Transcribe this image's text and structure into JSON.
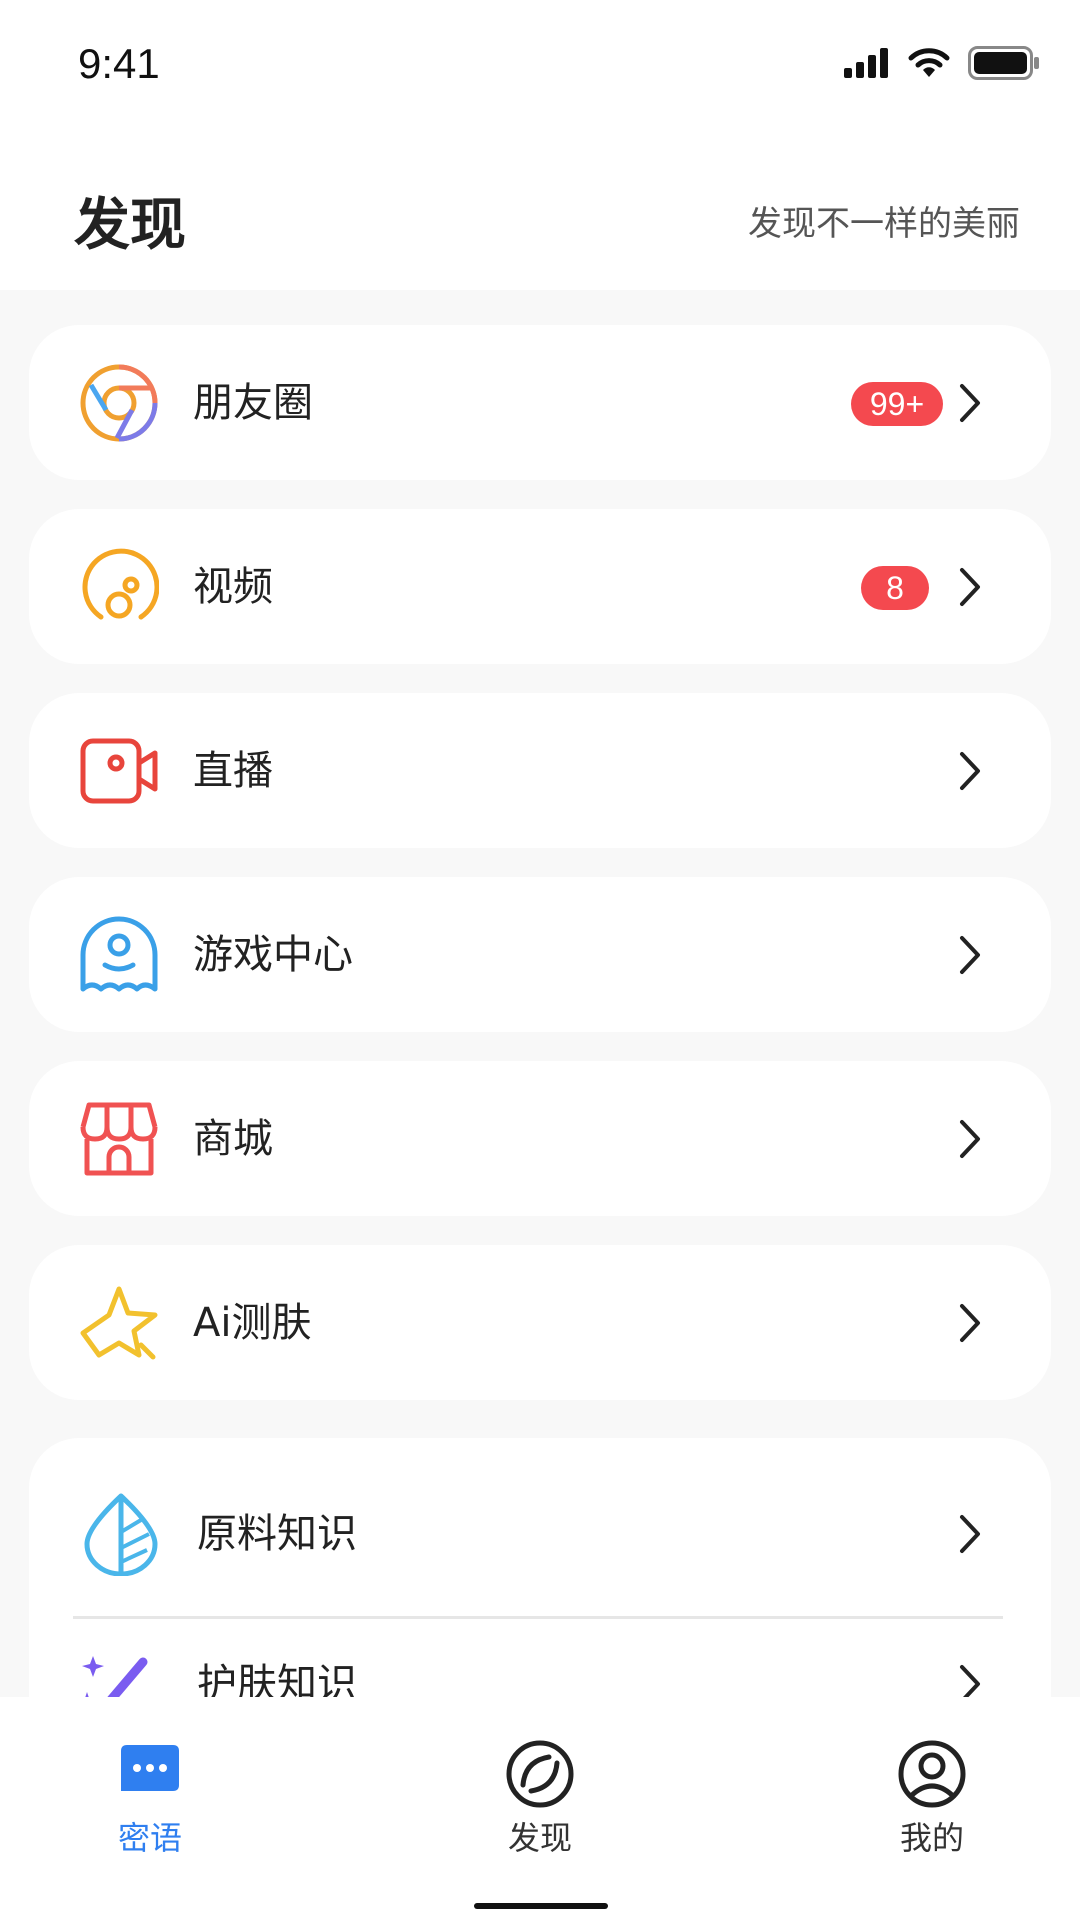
{
  "status": {
    "time": "9:41"
  },
  "header": {
    "title": "发现",
    "subtitle": "发现不一样的美丽"
  },
  "menu": [
    {
      "id": "moments",
      "label": "朋友圈",
      "badge": "99+"
    },
    {
      "id": "video",
      "label": "视频",
      "badge": "8"
    },
    {
      "id": "live",
      "label": "直播",
      "badge": ""
    },
    {
      "id": "games",
      "label": "游戏中心",
      "badge": ""
    },
    {
      "id": "mall",
      "label": "商城",
      "badge": ""
    },
    {
      "id": "ai-skin",
      "label": "Ai测肤",
      "badge": ""
    }
  ],
  "knowledge": [
    {
      "id": "ingredient",
      "label": "原料知识"
    },
    {
      "id": "skincare",
      "label": "护肤知识"
    }
  ],
  "tabs": [
    {
      "label": "密语",
      "active": true
    },
    {
      "label": "发现",
      "active": false
    },
    {
      "label": "我的",
      "active": false
    }
  ],
  "colors": {
    "accent": "#2f7ff0",
    "badge": "#f4494f",
    "moments_icon": "#f0a030",
    "video_icon": "#f5a623",
    "live_icon": "#e8453c",
    "games_icon": "#3aa0e8",
    "mall_icon": "#f05252",
    "ai_icon": "#f2c12e",
    "ingredient_icon": "#4ab6ea",
    "skincare_icon": "#7a5cf0"
  }
}
